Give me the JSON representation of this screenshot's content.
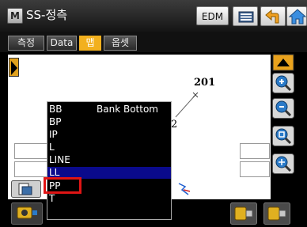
{
  "titlebar": {
    "app_icon_letter": "M",
    "title": "SS-정측",
    "edm_label": "EDM",
    "buttons": [
      "list-icon",
      "back-arrow-icon",
      "home-icon"
    ]
  },
  "tabs": [
    {
      "label": "측정",
      "active": false
    },
    {
      "label": "Data",
      "active": false
    },
    {
      "label": "맵",
      "active": true
    },
    {
      "label": "옵셋",
      "active": false
    }
  ],
  "map": {
    "point_label": "201"
  },
  "code_popup": {
    "items": [
      {
        "code": "BB",
        "desc": "Bank Bottom"
      },
      {
        "code": "BP",
        "desc": ""
      },
      {
        "code": "IP",
        "desc": ""
      },
      {
        "code": "L",
        "desc": ""
      },
      {
        "code": "LINE",
        "desc": ""
      },
      {
        "code": "LL",
        "desc": ""
      },
      {
        "code": "PP",
        "desc": ""
      },
      {
        "code": "T",
        "desc": ""
      }
    ],
    "selected_index": 5,
    "highlighted_index": 6
  },
  "colors": {
    "accent": "#f2b01e",
    "selection": "#0a0a8c",
    "highlight": "#e01515"
  },
  "right_toolbar": [
    "scroll-up-icon",
    "zoom-in-icon",
    "zoom-out-icon",
    "zoom-extent-icon",
    "pan-icon"
  ]
}
